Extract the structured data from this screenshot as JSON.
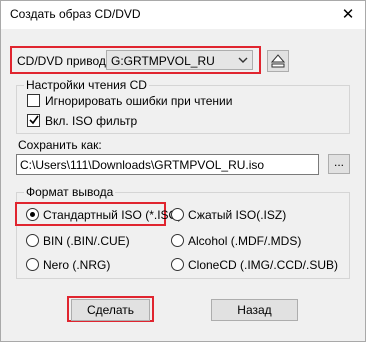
{
  "window": {
    "title": "Создать образ CD/DVD"
  },
  "drive": {
    "label": "CD/DVD привод:",
    "selected": "G:GRTMPVOL_RU"
  },
  "read_settings": {
    "title": "Настройки чтения CD",
    "ignore_errors": {
      "label": "Игнорировать ошибки при чтении",
      "checked": false
    },
    "iso_filter": {
      "label": "Вкл. ISO фильтр",
      "checked": true
    }
  },
  "save_as": {
    "label": "Сохранить как:",
    "path": "C:\\Users\\111\\Downloads\\GRTMPVOL_RU.iso",
    "browse_label": "..."
  },
  "output_format": {
    "title": "Формат вывода",
    "options": [
      {
        "label": "Стандартный ISO (*.ISO)",
        "selected": true
      },
      {
        "label": "Сжатый ISO(.ISZ)",
        "selected": false
      },
      {
        "label": "BIN (.BIN/.CUE)",
        "selected": false
      },
      {
        "label": "Alcohol (.MDF/.MDS)",
        "selected": false
      },
      {
        "label": "Nero (.NRG)",
        "selected": false
      },
      {
        "label": "CloneCD (.IMG/.CCD/.SUB)",
        "selected": false
      }
    ]
  },
  "buttons": {
    "make": "Сделать",
    "back": "Назад"
  },
  "colors": {
    "highlight": "#e0252f",
    "dialog_bg": "#f0f0f0"
  }
}
